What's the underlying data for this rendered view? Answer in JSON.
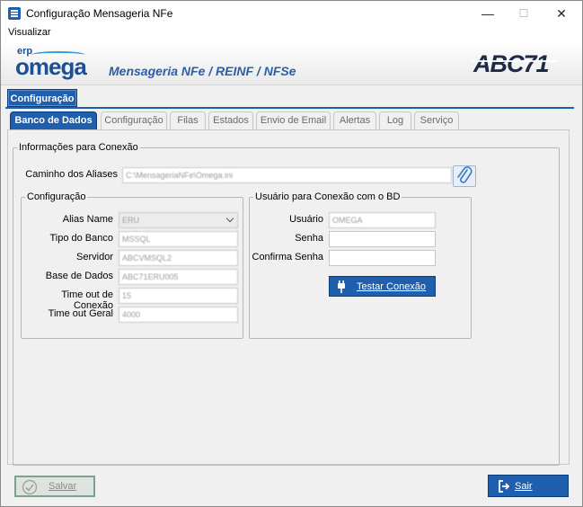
{
  "window": {
    "title": "Configuração Mensageria NFe",
    "minimize": "—",
    "maximize": "☐",
    "close": "✕"
  },
  "menu": {
    "items": [
      "Visualizar"
    ]
  },
  "banner": {
    "logo_small": "erp",
    "logo_main": "omega",
    "subtitle": "Mensageria NFe / REINF / NFSe",
    "brand_right": "ABC71"
  },
  "module_tab": "Configuração",
  "tabs": [
    "Banco de Dados",
    "Configuração",
    "Filas",
    "Estados",
    "Envio de Email",
    "Alertas",
    "Log",
    "Serviço"
  ],
  "active_tab": "Banco de Dados",
  "info_group": {
    "legend": "Informações para Conexão",
    "aliases_label": "Caminho dos Aliases",
    "aliases_value": "C:\\MensageriaNFe\\Omega.ini"
  },
  "config_group": {
    "legend": "Configuração",
    "fields": [
      {
        "label": "Alias Name",
        "value": "ERU"
      },
      {
        "label": "Tipo do Banco",
        "value": "MSSQL"
      },
      {
        "label": "Servidor",
        "value": "ABCVMSQL2"
      },
      {
        "label": "Base de Dados",
        "value": "ABC71ERU005"
      },
      {
        "label": "Time out de Conexão",
        "value": "15"
      },
      {
        "label": "Time out Geral",
        "value": "4000"
      }
    ]
  },
  "user_group": {
    "legend": "Usuário para Conexão com o BD",
    "fields": [
      {
        "label": "Usuário",
        "value": "OMEGA"
      },
      {
        "label": "Senha",
        "value": ""
      },
      {
        "label": "Confirma Senha",
        "value": ""
      }
    ],
    "test_button": "Testar Conexão"
  },
  "footer": {
    "save_button": "Salvar",
    "exit_button": "Sair"
  },
  "colors": {
    "accent": "#1f5fae",
    "border": "#c8c8c8"
  }
}
